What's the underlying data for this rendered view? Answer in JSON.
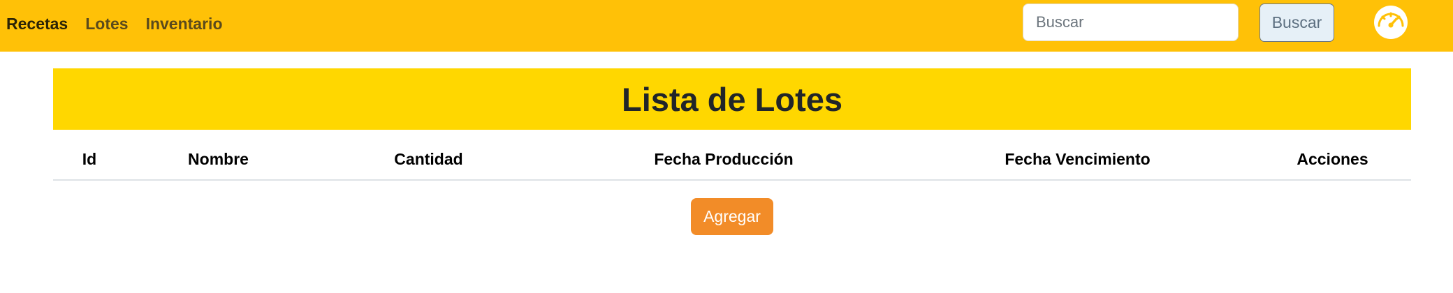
{
  "navbar": {
    "links": [
      {
        "label": "Recetas"
      },
      {
        "label": "Lotes"
      },
      {
        "label": "Inventario"
      }
    ],
    "search": {
      "placeholder": "Buscar",
      "value": "",
      "button_label": "Buscar"
    },
    "dashboard_icon": "gauge-icon",
    "background_color": "#ffc107"
  },
  "main": {
    "title": "Lista de Lotes",
    "banner_color": "#ffd700",
    "table": {
      "columns": [
        "Id",
        "Nombre",
        "Cantidad",
        "Fecha Producción",
        "Fecha Vencimiento",
        "Acciones"
      ],
      "rows": []
    },
    "add_button_label": "Agregar",
    "add_button_color": "#f28c28"
  }
}
